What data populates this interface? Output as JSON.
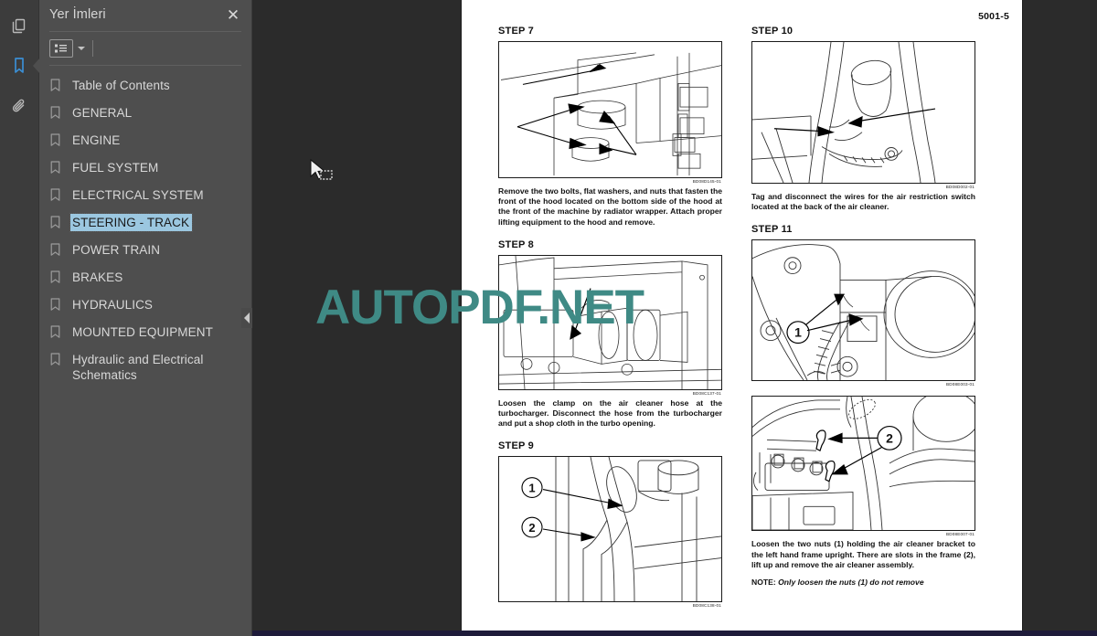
{
  "window": {
    "accent_blue": "#3b8fd4",
    "panel_bg": "#4e4e4e",
    "rail_bg": "#3c3c3c",
    "viewer_bg": "#2b2b2b",
    "selection_bg": "#9bc7e0",
    "watermark_color": "#3f8a85"
  },
  "icon_rail": {
    "items": [
      {
        "name": "thumbnails-icon",
        "label": "Sayfa Küçük Resimleri",
        "active": false
      },
      {
        "name": "bookmark-icon",
        "label": "Yer İmleri",
        "active": true
      },
      {
        "name": "attachment-icon",
        "label": "Ekler",
        "active": false
      }
    ]
  },
  "bookmarks_panel": {
    "title": "Yer İmleri",
    "close_label": "✕",
    "toolbar": {
      "options_label": "Seçenekler",
      "options_icon": "list-options-icon",
      "caret_icon": "chevron-down-icon"
    },
    "collapse_icon": "collapse-panel-icon",
    "items": [
      {
        "label": "Table of Contents",
        "selected": false
      },
      {
        "label": "GENERAL",
        "selected": false
      },
      {
        "label": "ENGINE",
        "selected": false
      },
      {
        "label": "FUEL SYSTEM",
        "selected": false
      },
      {
        "label": "ELECTRICAL SYSTEM",
        "selected": false
      },
      {
        "label": "STEERING - TRACK",
        "selected": true
      },
      {
        "label": "POWER TRAIN",
        "selected": false
      },
      {
        "label": "BRAKES",
        "selected": false
      },
      {
        "label": "HYDRAULICS",
        "selected": false
      },
      {
        "label": "MOUNTED EQUIPMENT",
        "selected": false
      },
      {
        "label": "Hydraulic and Electrical Schematics",
        "selected": false
      }
    ]
  },
  "watermark": {
    "text": "AUTOPDF.NET"
  },
  "document": {
    "page_number": "5001-5",
    "left_column": [
      {
        "heading": "STEP 7",
        "figure_code": "BD08D145-01",
        "caption": "Remove the two bolts, flat washers, and nuts that fasten the front of the hood located on the bottom side of the hood at the front of the machine by radiator wrapper. Attach proper lifting equipment to the hood and remove."
      },
      {
        "heading": "STEP 8",
        "figure_code": "BD08C137-01",
        "caption": "Loosen the clamp on the air cleaner hose at the turbocharger. Disconnect the hose from the turbocharger and put a shop cloth in the turbo opening."
      },
      {
        "heading": "STEP 9",
        "figure_code": "BD08C138-01",
        "caption": "",
        "callouts": [
          "1",
          "2"
        ]
      }
    ],
    "right_column": [
      {
        "heading": "STEP 10",
        "figure_code": "BD08D002-01",
        "caption": "Tag and disconnect the wires for the air restriction switch located at the back of the air cleaner."
      },
      {
        "heading": "STEP 11",
        "figure_code": "BD08E003-01",
        "caption": "",
        "callouts": [
          "1"
        ]
      },
      {
        "heading": "",
        "figure_code": "BD08E007-01",
        "caption": "Loosen the two nuts (1) holding the air cleaner bracket to the left hand frame upright. There are slots in the frame (2), lift up and remove the air cleaner assembly.",
        "callouts": [
          "2"
        ]
      }
    ],
    "note": {
      "label": "NOTE:",
      "text": "Only loosen the nuts (1) do not remove"
    }
  }
}
